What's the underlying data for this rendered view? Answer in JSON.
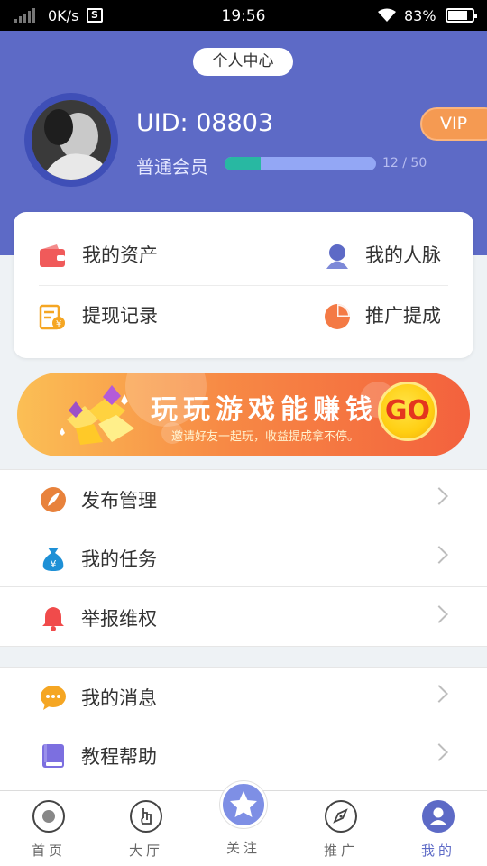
{
  "status_bar": {
    "speed": "0K/s",
    "sim_label": "S",
    "time": "19:56",
    "battery_pct": "83%",
    "battery_level": 0.83
  },
  "header": {
    "title": "个人中心",
    "uid": "UID: 08803",
    "member_level": "普通会员",
    "progress_text": "12 / 50",
    "progress_value": 12,
    "progress_max": 50,
    "vip_label": "VIP"
  },
  "assets": {
    "items": [
      {
        "label": "我的资产",
        "icon": "wallet-icon"
      },
      {
        "label": "我的人脉",
        "icon": "contacts-icon"
      },
      {
        "label": "提现记录",
        "icon": "withdraw-record-icon"
      },
      {
        "label": "推广提成",
        "icon": "pie-chart-icon"
      }
    ]
  },
  "banner": {
    "title": "玩玩游戏能赚钱",
    "subtitle": "邀请好友一起玩，收益提成拿不停。",
    "go_label": "GO"
  },
  "menu": {
    "group1": [
      {
        "label": "发布管理",
        "icon": "feather-icon"
      },
      {
        "label": "我的任务",
        "icon": "money-bag-icon"
      },
      {
        "label": "举报维权",
        "icon": "bell-icon"
      }
    ],
    "group2": [
      {
        "label": "我的消息",
        "icon": "chat-bubble-icon"
      },
      {
        "label": "教程帮助",
        "icon": "book-icon"
      }
    ]
  },
  "tabbar": {
    "tabs": [
      {
        "label": "首页",
        "icon": "home-icon"
      },
      {
        "label": "大厅",
        "icon": "hand-pointer-icon"
      },
      {
        "label": "关注",
        "icon": "star-icon"
      },
      {
        "label": "推广",
        "icon": "compass-icon"
      },
      {
        "label": "我的",
        "icon": "user-icon"
      }
    ],
    "active_index": 4
  },
  "colors": {
    "header_bg": "#5d6ac6",
    "accent": "#5d6ac6",
    "vip": "#f59a52",
    "progress_fill": "#28b8a2"
  }
}
